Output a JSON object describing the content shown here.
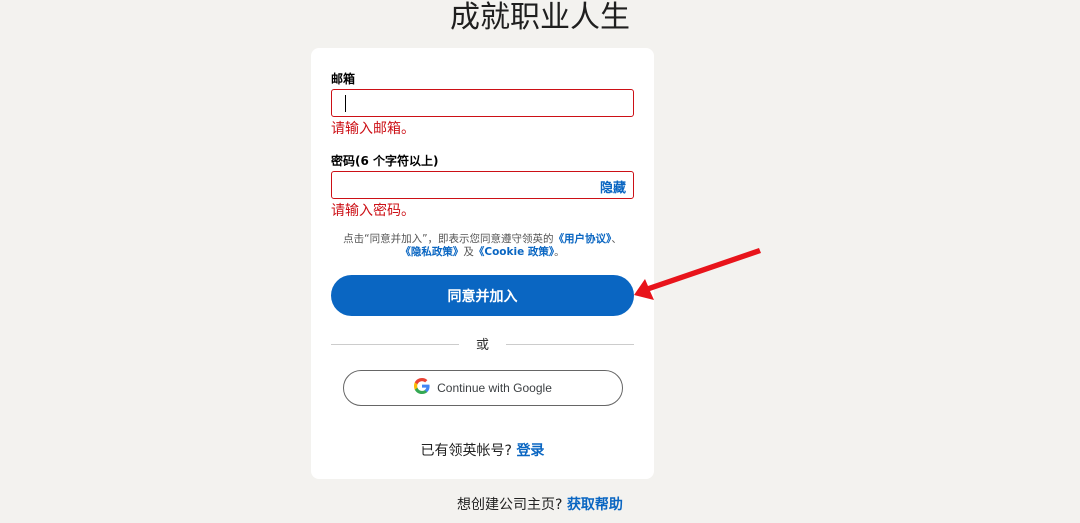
{
  "page": {
    "headline": "成就职业人生"
  },
  "email": {
    "label": "邮箱",
    "value": "",
    "error": "请输入邮箱。"
  },
  "password": {
    "label": "密码(6 个字符以上)",
    "value": "",
    "toggle_label": "隐藏",
    "error": "请输入密码。"
  },
  "terms": {
    "prefix": "点击“同意并加入”，即表示您同意遵守领英的",
    "user_agreement": "《用户协议》",
    "sep1": "、",
    "privacy_policy": "《隐私政策》",
    "sep2": "及",
    "cookie_policy": "《Cookie 政策》",
    "suffix": "。"
  },
  "join_button": {
    "label": "同意并加入"
  },
  "divider": {
    "text": "或"
  },
  "google_button": {
    "label": "Continue with Google",
    "icon": "google-g-icon"
  },
  "signin": {
    "prompt": "已有领英帐号?",
    "link": "登录"
  },
  "footer": {
    "prompt": "想创建公司主页?",
    "link": "获取帮助"
  },
  "colors": {
    "accent": "#0a66c2",
    "error": "#cc1016",
    "annotation_arrow": "#e8141b"
  }
}
